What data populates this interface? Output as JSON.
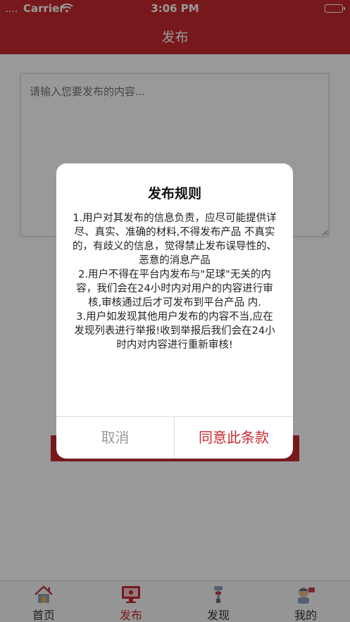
{
  "status_bar": {
    "signal": "....",
    "carrier": "Carrier",
    "time": "3:06 PM"
  },
  "nav": {
    "title": "发布"
  },
  "compose": {
    "placeholder": "请输入您要发布的内容...",
    "submit_label": ""
  },
  "tabs": [
    {
      "label": "首页",
      "icon": "home-icon",
      "active": false
    },
    {
      "label": "发布",
      "icon": "monitor-icon",
      "active": true
    },
    {
      "label": "发现",
      "icon": "tool-icon",
      "active": false
    },
    {
      "label": "我的",
      "icon": "profile-icon",
      "active": false
    }
  ],
  "dialog": {
    "title": "发布规则",
    "rules": [
      "1.用户对其发布的信息负责，应尽可能提供详尽、真实、准确的材料,不得发布产品 不真实的，有歧义的信息，觉得禁止发布误导性的、恶意的消息产品",
      "2.用户不得在平台内发布与\"足球\"无关的内容，我们会在24小时内对用户的内容进行审核,审核通过后才可发布到平台产品 内.",
      "3.用户如发现其他用户发布的内容不当,应在发现列表进行举报!收到举报后我们会在24小时内对内容进行重新审核!"
    ],
    "cancel_label": "取消",
    "agree_label": "同意此条款"
  },
  "colors": {
    "brand": "#c62a30",
    "overlay": "rgba(0,0,0,0.40)",
    "cancel_text": "#9a9a9a"
  }
}
